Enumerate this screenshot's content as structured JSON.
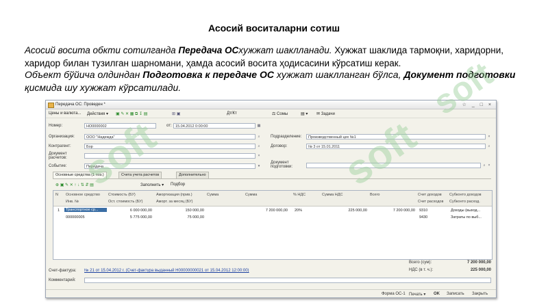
{
  "slide": {
    "title": "Асосий воситаларни сотиш",
    "p1_a": "Асосий восита обкти сотилганда ",
    "p1_b": "Передача ОС",
    "p1_c": "хужжат шаклланади.",
    "p1_d": " Хужжат шаклида тармоқни, харидорни, харидор билан тузилган шарномани, ҳамда асосий восита ҳодисасини кўрсатиш керак.",
    "p2_a": "Объект бўйича олдиндан ",
    "p2_b": "Подготовка к передаче ОС",
    "p2_c": " хужжат шаклланган бўлса, ",
    "p2_d": "Документ подготовки",
    "p2_e": " қисмида шу хужжат кўрсатилади.",
    "watermark": "soft"
  },
  "window": {
    "title": "Передача ОС: Проведен *",
    "toolbar": [
      "Цены и валюта...",
      "Действия ▾",
      "Создать",
      "Оплата",
      "Скрыть",
      "Сохранить",
      "Печать"
    ],
    "fields": {
      "nomer_label": "Номер:",
      "nomer": "НО0000002",
      "ot_label": "от:",
      "date": "15.04.2012 0:00:00",
      "org_label": "Организация:",
      "org": "ООО \"Надежда\"",
      "podr_label": "Подразделение:",
      "podr": "Производственный цех №1",
      "kontr_label": "Контрагент:",
      "kontr": "Бор",
      "dog_label": "Договор:",
      "dog": "№ 3 от 15.01.2011",
      "docras_label": "Документ расчетов:",
      "sob_label": "Событие:",
      "sob": "Передача",
      "docpod_label": "Документ подготовки:"
    },
    "tabs": [
      "Основные средства (1 поз.)",
      "Счета учета расчетов",
      "Дополнительно"
    ],
    "grid_toolbar": [
      "Заполнить ▾",
      "Подбор"
    ],
    "columns": {
      "n": "N",
      "os": "Основное средство",
      "inv": "Инв. №",
      "stoim": "Стоимость (БУ)",
      "oststoim": "Ост. стоимость (БУ)",
      "amort": "Амортизация (прив.)",
      "amortza": "Аморт. за месяц (БУ)",
      "summa1": "Сумма",
      "summa2": "Сумма",
      "nds": "% НДС",
      "summands": "Сумма НДС",
      "vsego": "Всего",
      "schetdoh": "Счет доходов",
      "schetras": "Счет расходов",
      "subkdoh": "Субконто доходов",
      "subkras": "Субконто расход."
    },
    "rows": [
      {
        "n": "1",
        "os": "Транспортное ср...",
        "inv": "000000005",
        "stoim": "6 000 000,00",
        "oststoim": "5 775 000,00",
        "amort": "150 000,00",
        "amortza": "75 000,00",
        "summa": "7 200 000,00",
        "nds": "20%",
        "summands": "225 000,00",
        "vsego": "7 200 000,00",
        "schetdoh": "9310",
        "schetras": "9430",
        "subkdoh": "Доходы (выход...",
        "subkras": "Затраты по выб..."
      }
    ],
    "totals": {
      "vsego_label": "Всего (сум):",
      "vsego": "7 200 000,00",
      "nds_label": "НДС (в т. ч.):",
      "nds": "225 000,00"
    },
    "schetfaktura_label": "Счет-фактура:",
    "schetfaktura": "№ 21 от 15.04.2012 г. (Счет-фактура выданный Н00000000021 от 15.04.2012 12:00:00)",
    "comment_label": "Комментарий:",
    "footer": [
      "Форма ОС-1",
      "Печать ▾",
      "OK",
      "Записать",
      "Закрыть"
    ]
  }
}
